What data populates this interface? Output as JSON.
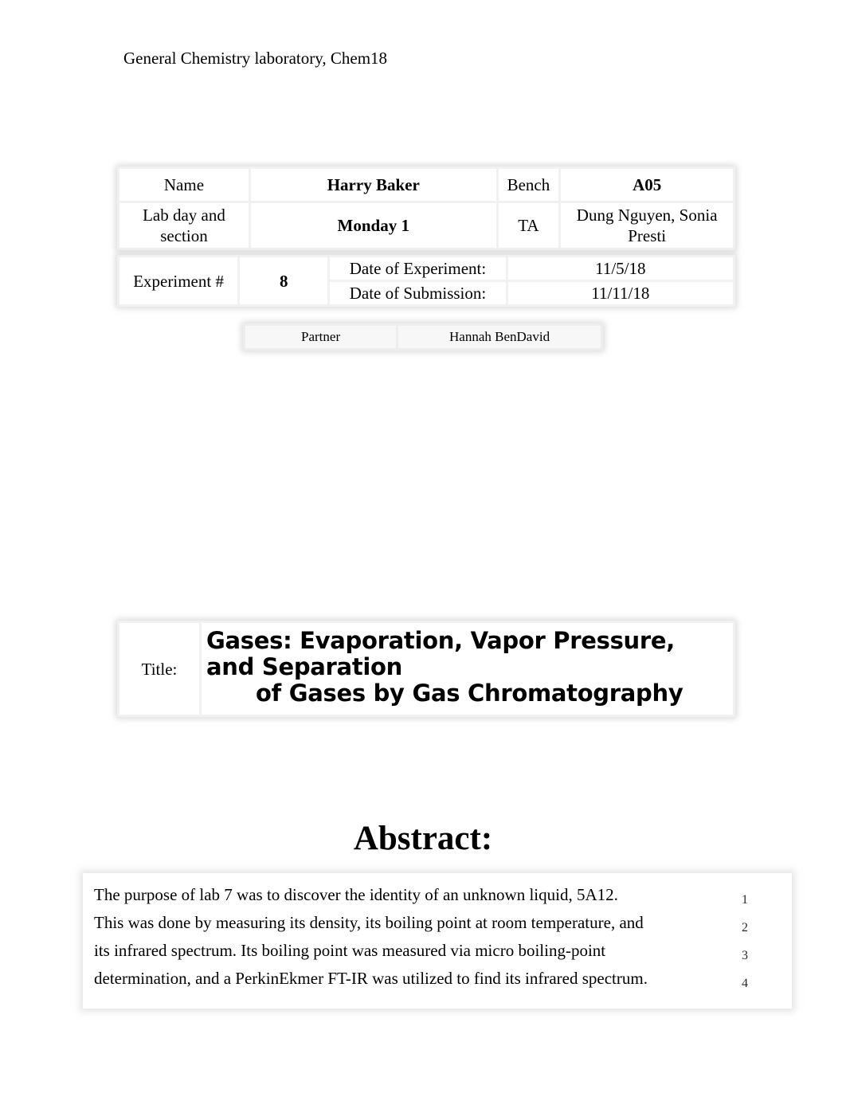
{
  "header": {
    "course_line": "General Chemistry laboratory, Chem18"
  },
  "info_table": {
    "name_label": "Name",
    "name_value": "Harry Baker",
    "bench_label": "Bench",
    "bench_value": "A05",
    "section_label": "Lab day and section",
    "section_value": "Monday 1",
    "ta_label": "TA",
    "ta_value": "Dung Nguyen, Sonia Presti"
  },
  "experiment_table": {
    "experiment_label": "Experiment #",
    "experiment_number": "8",
    "date_experiment_label": "Date of Experiment:",
    "date_experiment_value": "11/5/18",
    "date_submission_label": "Date of Submission:",
    "date_submission_value": "11/11/18"
  },
  "partner_table": {
    "partner_label": "Partner",
    "partner_value": "Hannah BenDavid"
  },
  "title_block": {
    "title_label": "Title:",
    "title_line_1": "Gases: Evaporation, Vapor Pressure, and Separation",
    "title_line_2": "of Gases by Gas Chromatography"
  },
  "abstract": {
    "heading": "Abstract:",
    "lines": [
      "The purpose of lab 7 was to discover the identity of an unknown liquid, 5A12.",
      "This was done by measuring its density, its boiling point at room temperature, and",
      "its infrared spectrum. Its boiling point was measured via micro boiling-point",
      "determination, and a PerkinEkmer FT-IR was utilized to find its infrared spectrum."
    ],
    "line_numbers": [
      "1",
      "2",
      "3",
      "4"
    ]
  }
}
